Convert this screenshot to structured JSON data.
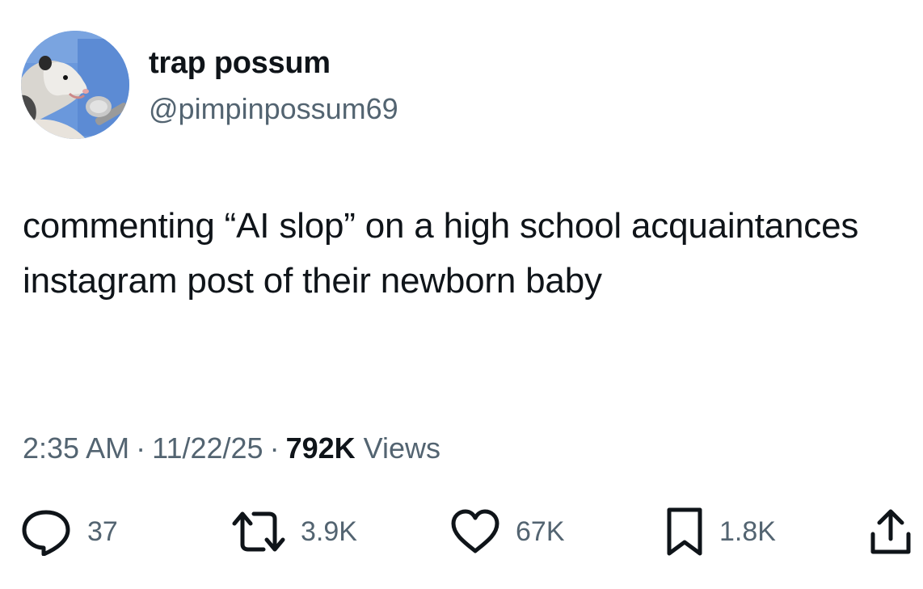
{
  "author": {
    "display_name": "trap possum",
    "handle": "@pimpinpossum69",
    "avatar_icon": "possum-avatar"
  },
  "tweet": {
    "text": "commenting “AI slop” on a high school acquaintances instagram post of their newborn baby"
  },
  "meta": {
    "time": "2:35 AM",
    "date": "11/22/25",
    "separator": "·",
    "views_count": "792K",
    "views_label": "Views"
  },
  "actions": {
    "replies": "37",
    "reposts": "3.9K",
    "likes": "67K",
    "bookmarks": "1.8K"
  },
  "colors": {
    "text_primary": "#0f1419",
    "text_secondary": "#536471",
    "avatar_bg": "#5b8fd9"
  }
}
